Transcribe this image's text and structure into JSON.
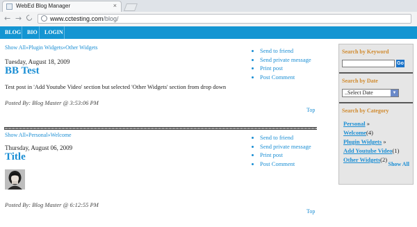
{
  "browser": {
    "tab_title": "WebEd Blog Manager",
    "tab_close": "×",
    "back": "←",
    "forward": "→",
    "reload": "C",
    "url_host": "www.cctesting.com",
    "url_path": "/blog/"
  },
  "nav": {
    "items": [
      "BLOG",
      "BIO",
      "LOGIN"
    ]
  },
  "posts": [
    {
      "breadcrumb": [
        "Show All",
        "»",
        "Plugin Widgets",
        "»",
        "Other Widgets"
      ],
      "date": "Tuesday, August 18, 2009",
      "title": "BB Test",
      "body": "Test post in 'Add Youtube Video' section but selected 'Other Widgets' section from drop down",
      "posted_by": "Posted By: Blog Master @ 3:53:06 PM",
      "top": "Top",
      "actions": [
        "Send to friend",
        "Send private message",
        "Print post",
        "Post Comment"
      ]
    },
    {
      "breadcrumb": [
        "Show All",
        "»",
        "Personal",
        "»",
        "Welcome"
      ],
      "date": "Thursday, August 06, 2009",
      "title": "Title",
      "posted_by": "Posted By: Blog Master @ 6:12:55 PM",
      "top": "Top",
      "actions": [
        "Send to friend",
        "Send private message",
        "Print post",
        "Post Comment"
      ]
    }
  ],
  "sidebar": {
    "keyword_heading": "Search by Keyword",
    "go_label": "Go",
    "date_heading": "Search by Date",
    "date_select_value": "..Select Date",
    "category_heading": "Search by Category",
    "categories": [
      {
        "name": "Personal",
        "suffix": " »"
      },
      {
        "name": "Welcome",
        "suffix": "(4)"
      },
      {
        "name": "Plugin Widgets",
        "suffix": " »"
      },
      {
        "name": "Add Youtube Video",
        "suffix": "(1)"
      },
      {
        "name": "Other Widgets",
        "suffix": "(2)"
      }
    ],
    "show_all": "Show All"
  },
  "colors": {
    "nav_bg": "#1495d2",
    "link": "#1a8ed4",
    "sidebar_heading": "#d08a2e"
  }
}
